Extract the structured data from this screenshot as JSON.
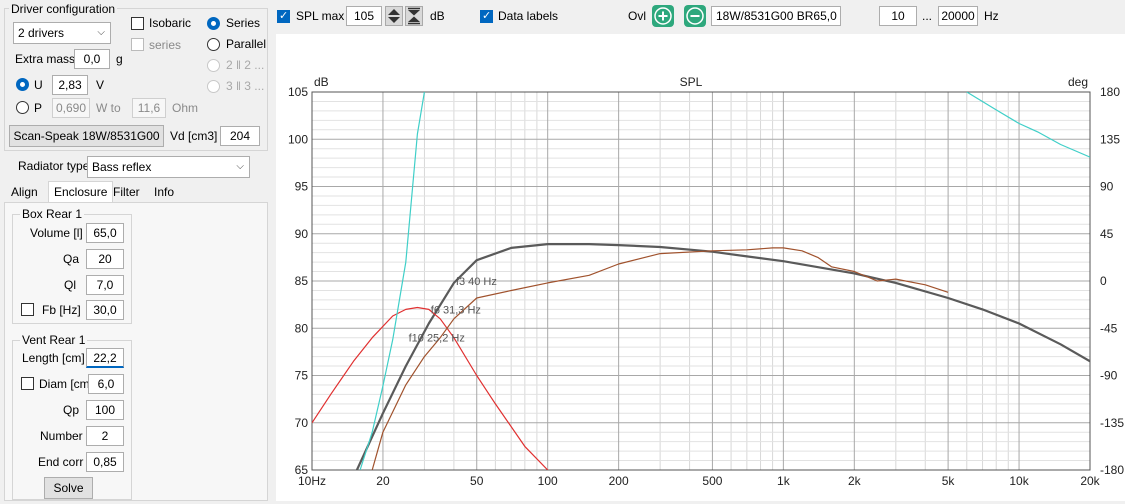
{
  "left": {
    "driver_config": {
      "title": "Driver configuration",
      "drivers_select": "2 drivers",
      "isobaric": "Isobaric",
      "series_sub": "series",
      "series": "Series",
      "parallel": "Parallel",
      "opt_2x2": "2 ‖ 2 ...",
      "opt_3x3": "3 ‖ 3 ...",
      "extra_mass_label": "Extra mass",
      "extra_mass_value": "0,0",
      "extra_mass_unit": "g",
      "u_label": "U",
      "u_value": "2,83",
      "u_unit": "V",
      "p_label": "P",
      "p_value": "0,690",
      "p_unit": "W to",
      "ohm_value": "11,6",
      "ohm_unit": "Ohm",
      "driver_button": "Scan-Speak 18W/8531G00",
      "vd_label": "Vd [cm3]",
      "vd_value": "204"
    },
    "radiator_type_label": "Radiator type",
    "radiator_type_value": "Bass reflex",
    "tabs": [
      "Align",
      "Enclosure",
      "Filter",
      "Info"
    ],
    "box": {
      "title": "Box Rear 1",
      "volume_label": "Volume [l]",
      "volume_value": "65,0",
      "qa_label": "Qa",
      "qa_value": "20",
      "ql_label": "Ql",
      "ql_value": "7,0",
      "fb_label": "Fb [Hz]",
      "fb_value": "30,0"
    },
    "vent": {
      "title": "Vent Rear 1",
      "length_label": "Length [cm]",
      "length_value": "22,2",
      "diam_label": "Diam [cm]",
      "diam_value": "6,0",
      "qp_label": "Qp",
      "qp_value": "100",
      "number_label": "Number",
      "number_value": "2",
      "endcorr_label": "End corr",
      "endcorr_value": "0,85",
      "solve_button": "Solve"
    }
  },
  "toolbar": {
    "spl_max_label": "SPL max",
    "spl_max_value": "105",
    "db_unit": "dB",
    "data_labels": "Data labels",
    "ovl_label": "Ovl",
    "overlay_name": "18W/8531G00 BR65,0",
    "freq_min": "10",
    "freq_sep": "...",
    "freq_max": "20000",
    "freq_unit": "Hz"
  },
  "colors": {
    "accent": "#0067c0",
    "green": "#2ea87d",
    "spl_curve": "#5a5a5a",
    "cyan_curve": "#3fcfc8",
    "red_curve": "#e03030",
    "brown_curve": "#a0522d"
  },
  "chart_data": {
    "type": "line",
    "title": "SPL",
    "ylabel_left": "dB",
    "ylabel_right": "deg",
    "xscale": "log",
    "xlim": [
      10,
      20000
    ],
    "ylim": [
      65,
      105
    ],
    "ylim_right": [
      -180,
      180
    ],
    "x_tick_labels": [
      "10Hz",
      "20",
      "50",
      "100",
      "200",
      "500",
      "1k",
      "2k",
      "5k",
      "10k",
      "20k"
    ],
    "x_ticks": [
      10,
      20,
      50,
      100,
      200,
      500,
      1000,
      2000,
      5000,
      10000,
      20000
    ],
    "y_ticks": [
      65,
      70,
      75,
      80,
      85,
      90,
      95,
      100,
      105
    ],
    "y_tick_labels": [
      "65",
      "70",
      "75",
      "80",
      "85",
      "90",
      "95",
      "100",
      "105"
    ],
    "y_right_tick_labels": [
      "-180",
      "-135",
      "-90",
      "-45",
      "0",
      "45",
      "90",
      "135",
      "180"
    ],
    "annotations": [
      {
        "text": "f3 40 Hz",
        "x": 40,
        "y": 85
      },
      {
        "text": "f6 31,3 Hz",
        "x": 31.3,
        "y": 82
      },
      {
        "text": "f10 25,2 Hz",
        "x": 25.2,
        "y": 79
      }
    ],
    "series": [
      {
        "color": "#5a5a5a",
        "x": [
          15.5,
          20,
          25,
          31.3,
          40,
          50,
          70,
          100,
          150,
          200,
          300,
          500,
          700,
          1000,
          2000,
          3000,
          5000,
          7000,
          10000,
          15000,
          20000
        ],
        "y": [
          65,
          71,
          76,
          80.5,
          84.8,
          87.2,
          88.5,
          88.9,
          88.9,
          88.8,
          88.6,
          88.1,
          87.6,
          87.1,
          85.8,
          84.8,
          83.2,
          82.0,
          80.5,
          78.3,
          76.5
        ]
      },
      {
        "color": "#e03030",
        "x": [
          10,
          12,
          15,
          18,
          22,
          25,
          28,
          31.3,
          35,
          40,
          50,
          60,
          80,
          100,
          120,
          140
        ],
        "y": [
          70,
          73,
          76.5,
          79,
          81.3,
          82,
          82.2,
          82,
          81,
          79,
          75,
          72,
          67.5,
          65,
          63,
          61
        ]
      },
      {
        "color": "#a0522d",
        "x": [
          18,
          20,
          25,
          30,
          35,
          40,
          50,
          70,
          100,
          150,
          200,
          300,
          500,
          700,
          900,
          1000,
          1200,
          1400,
          1600,
          2000,
          2500,
          3000,
          4000,
          5000
        ],
        "y": [
          65,
          69,
          74,
          77,
          79,
          81,
          83.2,
          84,
          84.8,
          85.6,
          86.8,
          87.9,
          88.2,
          88.3,
          88.5,
          88.5,
          88.2,
          87.5,
          86.5,
          86.0,
          85.0,
          85.2,
          84.6,
          83.8
        ]
      },
      {
        "color": "#3fcfc8",
        "axis": "right",
        "x": [
          16,
          18,
          20,
          22,
          25,
          28,
          30
        ],
        "y": [
          -180,
          -144,
          -100,
          -56,
          18,
          140,
          180
        ]
      },
      {
        "color": "#3fcfc8",
        "axis": "right",
        "x": [
          6000,
          8000,
          10000,
          12000,
          15000,
          20000
        ],
        "y": [
          180,
          163,
          150,
          142,
          130,
          118
        ]
      }
    ]
  }
}
